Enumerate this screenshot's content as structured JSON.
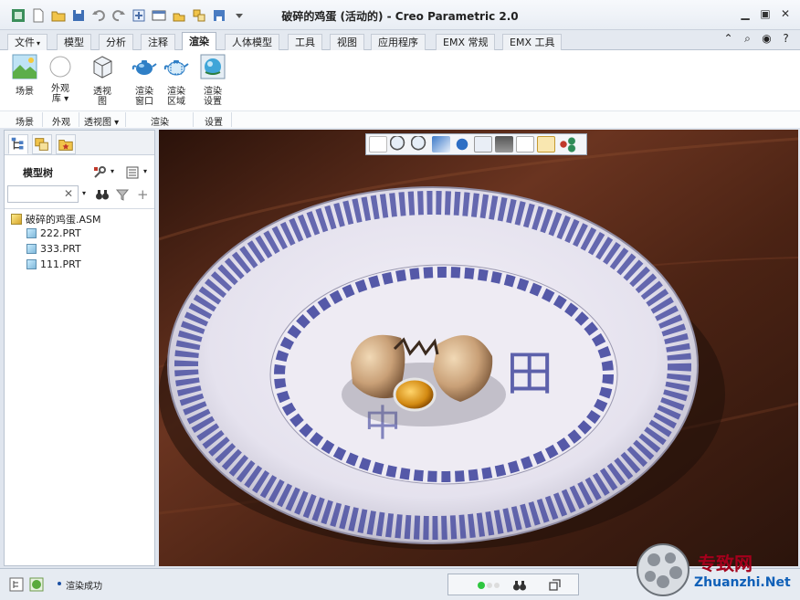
{
  "window": {
    "title": "破碎的鸡蛋 (活动的) - Creo Parametric 2.0"
  },
  "tabs": [
    {
      "label": "文件"
    },
    {
      "label": "模型"
    },
    {
      "label": "分析"
    },
    {
      "label": "注释"
    },
    {
      "label": "渲染"
    },
    {
      "label": "人体模型"
    },
    {
      "label": "工具"
    },
    {
      "label": "视图"
    },
    {
      "label": "应用程序"
    },
    {
      "label": "EMX 常规"
    },
    {
      "label": "EMX 工具"
    }
  ],
  "ribbon": {
    "buttons": [
      {
        "label": "场景"
      },
      {
        "label": "外观\n库 ▾"
      },
      {
        "label": "透视\n图"
      },
      {
        "label": "渲染\n窗口"
      },
      {
        "label": "渲染\n区域"
      },
      {
        "label": "渲染\n设置"
      }
    ],
    "groups": [
      {
        "label": "场景"
      },
      {
        "label": "外观"
      },
      {
        "label": "透视图 ▾"
      },
      {
        "label": "渲染"
      },
      {
        "label": "设置"
      }
    ]
  },
  "model_tree": {
    "header": "模型树",
    "search_value": "",
    "root": "破碎的鸡蛋.ASM",
    "items": [
      {
        "label": "222.PRT"
      },
      {
        "label": "333.PRT"
      },
      {
        "label": "111.PRT"
      }
    ]
  },
  "status": {
    "message": "渲染成功"
  },
  "watermark": {
    "line1": "专致网",
    "line2": "Zhuanzhi.Net"
  },
  "colors": {
    "accent": "#1a4fa3",
    "plate_blue": "#3a3f9a",
    "wood": "#5a2c18"
  }
}
